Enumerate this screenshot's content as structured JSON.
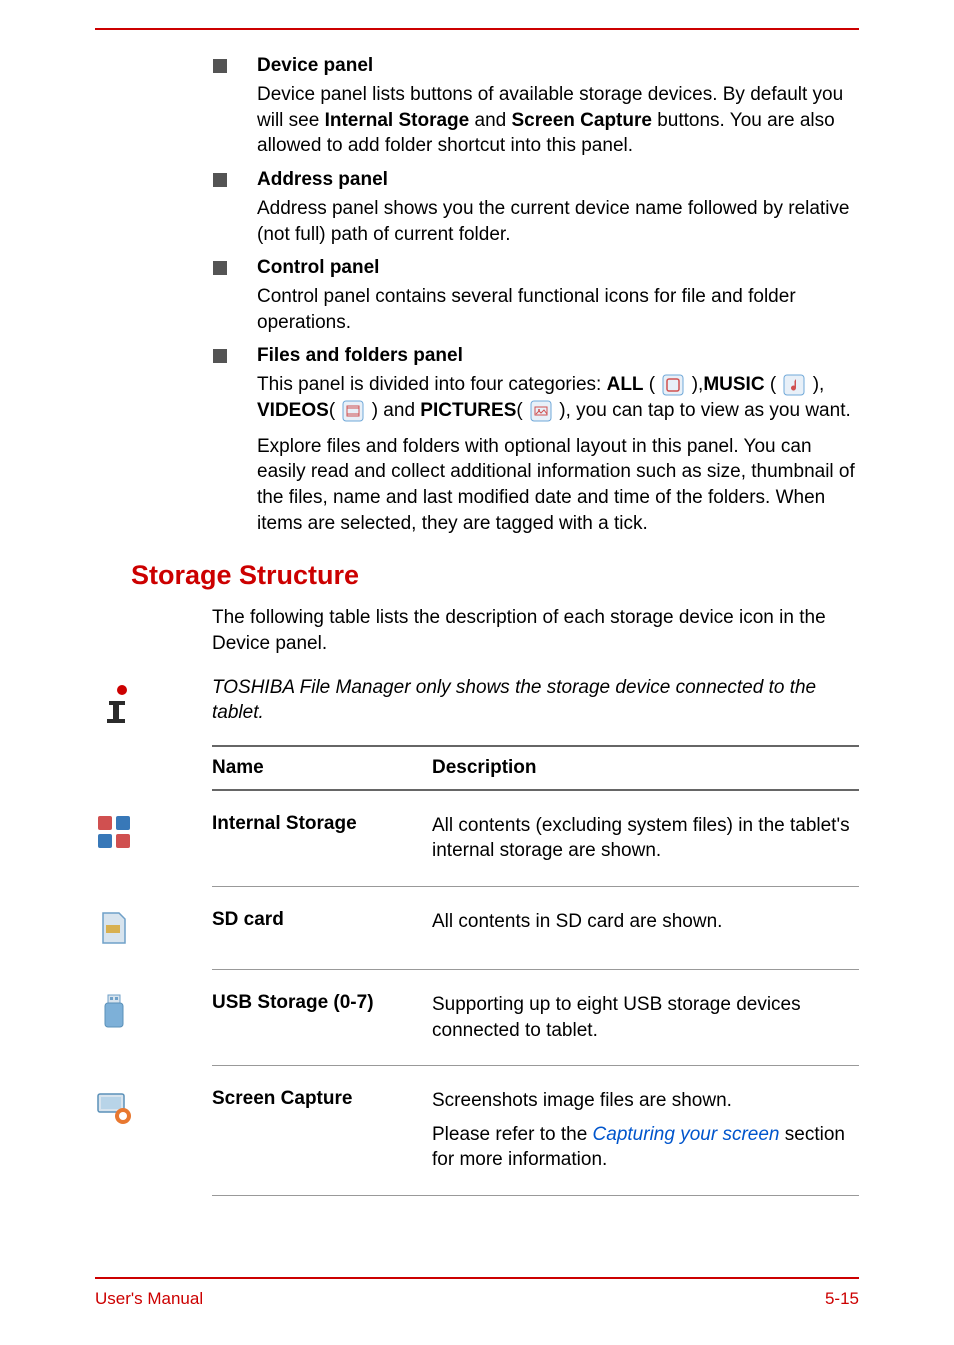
{
  "sections": [
    {
      "title": "Device panel",
      "body": "Device panel lists buttons of available storage devices. By default you will see <b>Internal Storage</b> and <b>Screen Capture</b> buttons. You are also allowed to add folder shortcut into this panel."
    },
    {
      "title": "Address panel",
      "body": "Address panel shows you the current device name followed by relative (not full) path of current folder."
    },
    {
      "title": "Control panel",
      "body": "Control panel contains several functional icons for file and folder operations."
    },
    {
      "title": "Files and folders panel",
      "body_parts": {
        "p1_a": "This panel is divided into four categories: ",
        "all": "ALL",
        "music": "MUSIC",
        "videos": "VIDEOS",
        "and": " and ",
        "pictures": "PICTURES",
        "p1_b": ", you can tap to view as you want.",
        "p2": "Explore files and folders with optional layout in this panel. You can easily read and collect additional information such as size, thumbnail of the files, name and last modified date and time of the folders. When items are selected, they are tagged with a tick."
      }
    }
  ],
  "heading": "Storage Structure",
  "intro": "The following table lists the description of each storage device icon in the Device panel.",
  "note": "TOSHIBA File Manager only shows the storage device connected to the tablet.",
  "table_header": {
    "name": "Name",
    "desc": "Description"
  },
  "rows": [
    {
      "name": "Internal Storage",
      "desc": "All contents (excluding system files) in the tablet's internal storage are shown."
    },
    {
      "name": "SD card",
      "desc": "All contents in SD card are shown."
    },
    {
      "name": "USB Storage (0-7)",
      "desc": "Supporting up to eight USB storage devices connected to tablet."
    },
    {
      "name": "Screen Capture",
      "desc_parts": {
        "p1": "Screenshots image files are shown.",
        "p2a": "Please refer to the ",
        "link": "Capturing your screen",
        "p2b": " section for more information."
      }
    }
  ],
  "footer": {
    "left": "User's Manual",
    "right": "5-15"
  }
}
